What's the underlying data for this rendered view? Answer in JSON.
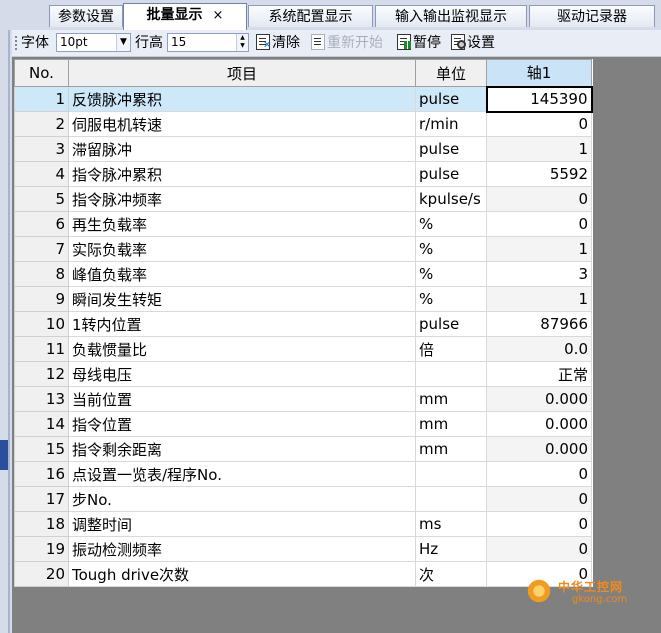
{
  "tabs": [
    {
      "label": "参数设置"
    },
    {
      "label": "批量显示",
      "active": true,
      "close": "×"
    },
    {
      "label": "系统配置显示"
    },
    {
      "label": "输入输出监视显示"
    },
    {
      "label": "驱动记录器"
    }
  ],
  "toolbar": {
    "font_label": "字体",
    "font_value": "10pt",
    "row_height_label": "行高",
    "row_height_value": "15",
    "clear_label": "清除",
    "restart_label": "重新开始",
    "pause_label": "暂停",
    "settings_label": "设置"
  },
  "table": {
    "headers": {
      "no": "No.",
      "item": "项目",
      "unit": "单位",
      "axis": "轴1"
    },
    "rows": [
      {
        "no": "1",
        "item": "反馈脉冲累积",
        "unit": "pulse",
        "value": "145390"
      },
      {
        "no": "2",
        "item": "伺服电机转速",
        "unit": "r/min",
        "value": "0"
      },
      {
        "no": "3",
        "item": "滞留脉冲",
        "unit": "pulse",
        "value": "1"
      },
      {
        "no": "4",
        "item": "指令脉冲累积",
        "unit": "pulse",
        "value": "5592"
      },
      {
        "no": "5",
        "item": "指令脉冲频率",
        "unit": "kpulse/s",
        "value": "0"
      },
      {
        "no": "6",
        "item": "再生负载率",
        "unit": "%",
        "value": "0"
      },
      {
        "no": "7",
        "item": "实际负载率",
        "unit": "%",
        "value": "1"
      },
      {
        "no": "8",
        "item": "峰值负载率",
        "unit": "%",
        "value": "3"
      },
      {
        "no": "9",
        "item": "瞬间发生转矩",
        "unit": "%",
        "value": "1"
      },
      {
        "no": "10",
        "item": "1转内位置",
        "unit": "pulse",
        "value": "87966"
      },
      {
        "no": "11",
        "item": "负载惯量比",
        "unit": "倍",
        "value": "0.0"
      },
      {
        "no": "12",
        "item": "母线电压",
        "unit": "",
        "value": "正常"
      },
      {
        "no": "13",
        "item": "当前位置",
        "unit": "mm",
        "value": "0.000"
      },
      {
        "no": "14",
        "item": "指令位置",
        "unit": "mm",
        "value": "0.000"
      },
      {
        "no": "15",
        "item": "指令剩余距离",
        "unit": "mm",
        "value": "0.000"
      },
      {
        "no": "16",
        "item": "点设置一览表/程序No.",
        "unit": "",
        "value": "0"
      },
      {
        "no": "17",
        "item": "步No.",
        "unit": "",
        "value": "0"
      },
      {
        "no": "18",
        "item": "调整时间",
        "unit": "ms",
        "value": "0"
      },
      {
        "no": "19",
        "item": "振动检测频率",
        "unit": "Hz",
        "value": "0"
      },
      {
        "no": "20",
        "item": "Tough drive次数",
        "unit": "次",
        "value": "0"
      }
    ]
  },
  "watermark": {
    "line1": "中华工控网",
    "line2": "gkong.com"
  },
  "colors": {
    "selected_row": "#cde8f8",
    "axis_header": "#cbe3f6",
    "background": "#808080"
  }
}
